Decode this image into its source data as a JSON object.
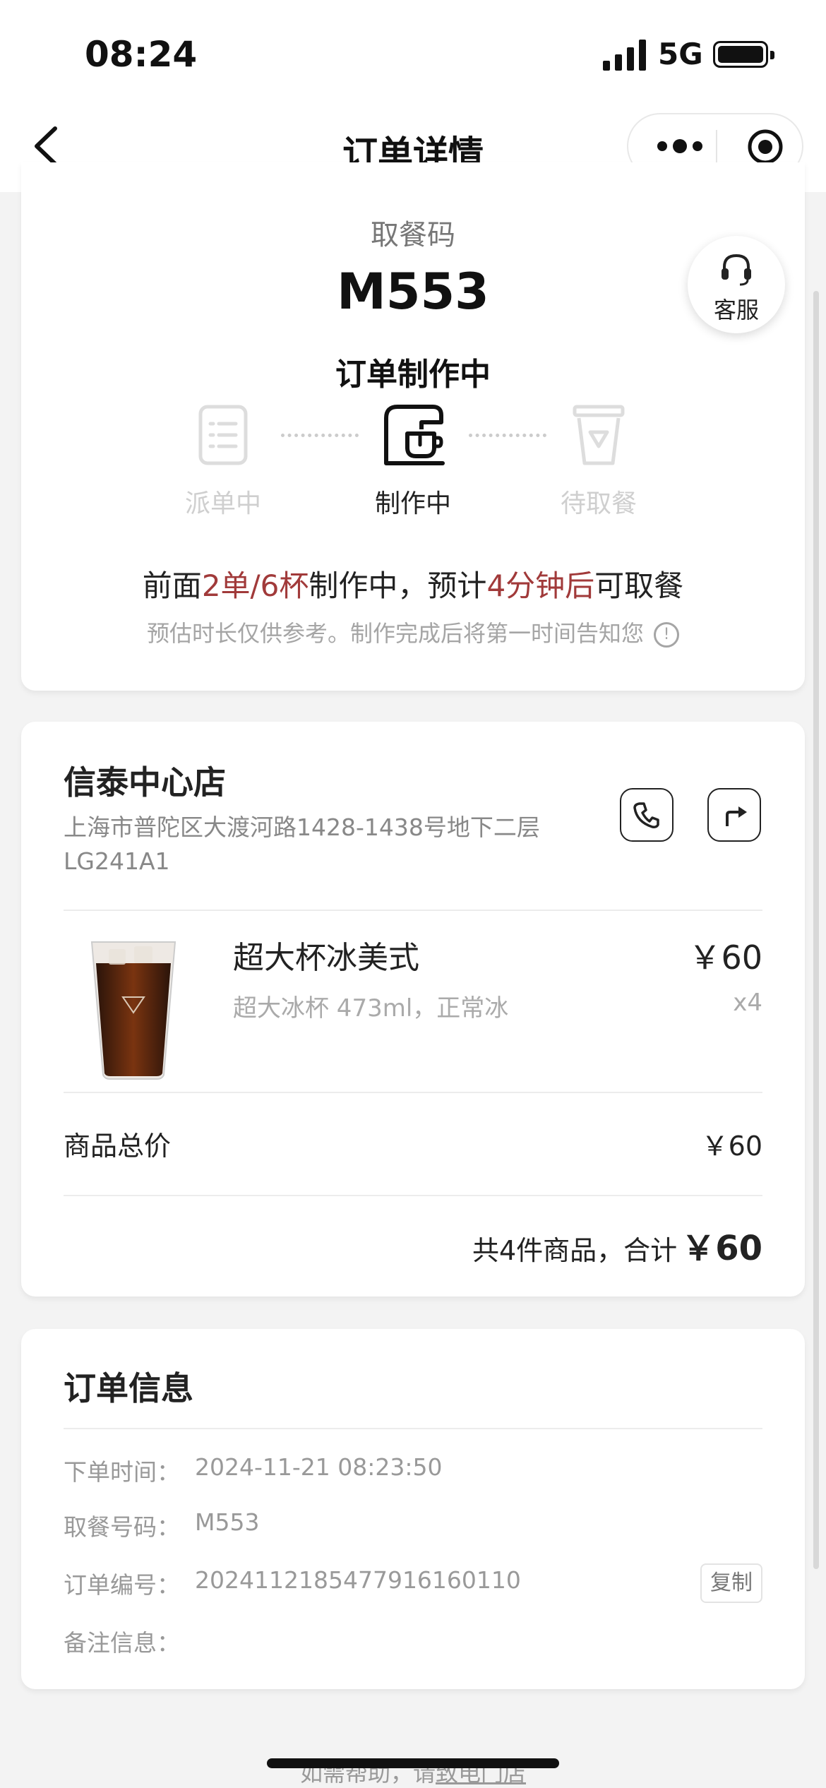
{
  "status_bar": {
    "time": "08:24",
    "network": "5G"
  },
  "nav": {
    "title": "订单详情"
  },
  "pickup": {
    "label": "取餐码",
    "code": "M553",
    "status_title": "订单制作中",
    "steps": [
      {
        "label": "派单中",
        "state": "inactive"
      },
      {
        "label": "制作中",
        "state": "active"
      },
      {
        "label": "待取餐",
        "state": "inactive"
      }
    ],
    "queue": {
      "prefix": "前面",
      "orders": "2单/6杯",
      "middle": "制作中，预计",
      "time": "4分钟后",
      "suffix": "可取餐"
    },
    "note": "预估时长仅供参考。制作完成后将第一时间告知您",
    "service_label": "客服"
  },
  "store": {
    "name": "信泰中心店",
    "address": "上海市普陀区大渡河路1428-1438号地下二层LG241A1",
    "product": {
      "name": "超大杯冰美式",
      "spec": "超大冰杯 473ml，正常冰",
      "price": "￥60",
      "qty": "x4"
    },
    "subtotal_label": "商品总价",
    "subtotal_value": "￥60",
    "total_text": "共4件商品，合计",
    "total_amount": "￥60"
  },
  "order_info": {
    "title": "订单信息",
    "rows": [
      {
        "label": "下单时间：",
        "value": "2024-11-21 08:23:50"
      },
      {
        "label": "取餐号码：",
        "value": "M553"
      },
      {
        "label": "订单编号：",
        "value": "20241121854779161601​10"
      },
      {
        "label": "备注信息：",
        "value": ""
      }
    ],
    "copy_label": "复制"
  },
  "footer": {
    "prefix": "如需帮助，请",
    "link": "致电门店"
  },
  "colors": {
    "highlight": "#a13a3a",
    "text": "#222222",
    "muted": "#999999"
  }
}
